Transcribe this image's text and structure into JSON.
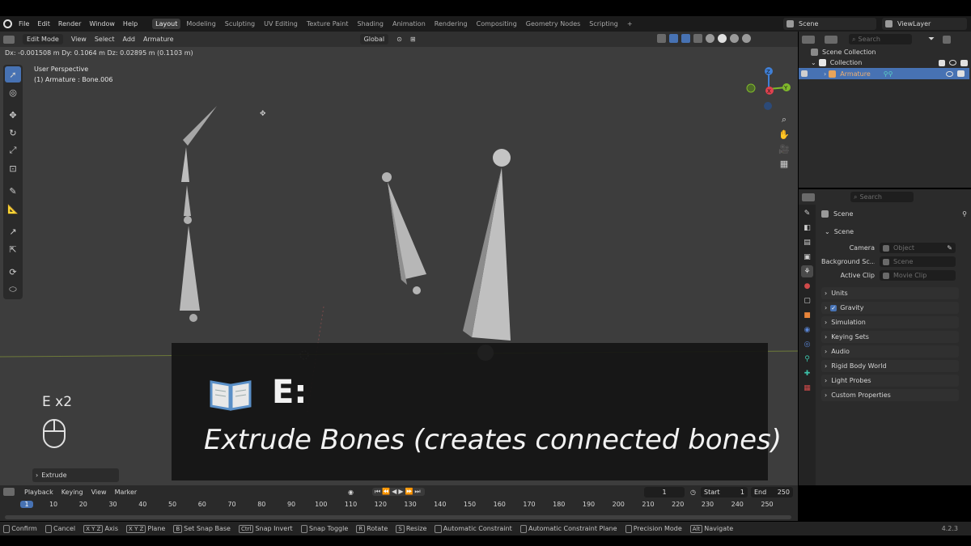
{
  "topbar": {
    "menu": [
      "File",
      "Edit",
      "Render",
      "Window",
      "Help"
    ],
    "workspaces": [
      "Layout",
      "Modeling",
      "Sculpting",
      "UV Editing",
      "Texture Paint",
      "Shading",
      "Animation",
      "Rendering",
      "Compositing",
      "Geometry Nodes",
      "Scripting"
    ],
    "active_workspace": "Layout",
    "add_tab": "+",
    "scene": "Scene",
    "view_layer": "ViewLayer"
  },
  "viewport": {
    "mode": "Edit Mode",
    "menus": [
      "View",
      "Select",
      "Add",
      "Armature"
    ],
    "orientation": "Global",
    "delta_readout": "Dx: -0.001508 m  Dy: 0.1064 m  Dz: 0.02895 m (0.1103 m)",
    "perspective_label": "User Perspective",
    "active_label": "(1) Armature : Bone.006",
    "gizmo_axes": {
      "x": "X",
      "y": "Y",
      "z": "Z"
    },
    "operator_panel": "Extrude",
    "colors": {
      "x_axis": "#e0414e",
      "y_axis": "#7fb82b",
      "z_axis": "#3f7fd6",
      "accent": "#4772b3"
    }
  },
  "overlay": {
    "key_name": "E:",
    "description": "Extrude Bones (creates connected bones)",
    "key_count": "E x2",
    "book_icon": "open-book-icon",
    "mouse_icon": "mouse-icon"
  },
  "outliner": {
    "search_placeholder": "Search",
    "root": "Scene Collection",
    "collection": "Collection",
    "item": "Armature"
  },
  "properties": {
    "search_placeholder": "Search",
    "breadcrumb": "Scene",
    "panel_title": "Scene",
    "fields": [
      {
        "label": "Camera",
        "placeholder": "Object"
      },
      {
        "label": "Background Sc...",
        "placeholder": "Scene"
      },
      {
        "label": "Active Clip",
        "placeholder": "Movie Clip"
      }
    ],
    "sections": [
      "Units",
      "Gravity",
      "Simulation",
      "Keying Sets",
      "Audio",
      "Rigid Body World",
      "Light Probes",
      "Custom Properties"
    ]
  },
  "timeline": {
    "menus": [
      "Playback",
      "Keying",
      "View",
      "Marker"
    ],
    "current_frame": "1",
    "start_label": "Start",
    "start_value": "1",
    "end_label": "End",
    "end_value": "250",
    "ruler": [
      "1",
      "10",
      "20",
      "30",
      "40",
      "50",
      "60",
      "70",
      "80",
      "90",
      "100",
      "110",
      "120",
      "130",
      "140",
      "150",
      "160",
      "170",
      "180",
      "190",
      "200",
      "210",
      "220",
      "230",
      "240",
      "250"
    ]
  },
  "statusbar": {
    "items": [
      {
        "key": "",
        "label": "Confirm"
      },
      {
        "key": "",
        "label": "Cancel"
      },
      {
        "key": "X Y Z",
        "label": "Axis"
      },
      {
        "key": "X Y Z",
        "label": "Plane"
      },
      {
        "key": "B",
        "label": "Set Snap Base"
      },
      {
        "key": "Ctrl",
        "label": "Snap Invert"
      },
      {
        "key": "",
        "label": "Snap Toggle"
      },
      {
        "key": "R",
        "label": "Rotate"
      },
      {
        "key": "S",
        "label": "Resize"
      },
      {
        "key": "",
        "label": "Automatic Constraint"
      },
      {
        "key": "",
        "label": "Automatic Constraint Plane"
      },
      {
        "key": "",
        "label": "Precision Mode"
      },
      {
        "key": "Alt",
        "label": "Navigate"
      }
    ],
    "version": "4.2.3"
  }
}
